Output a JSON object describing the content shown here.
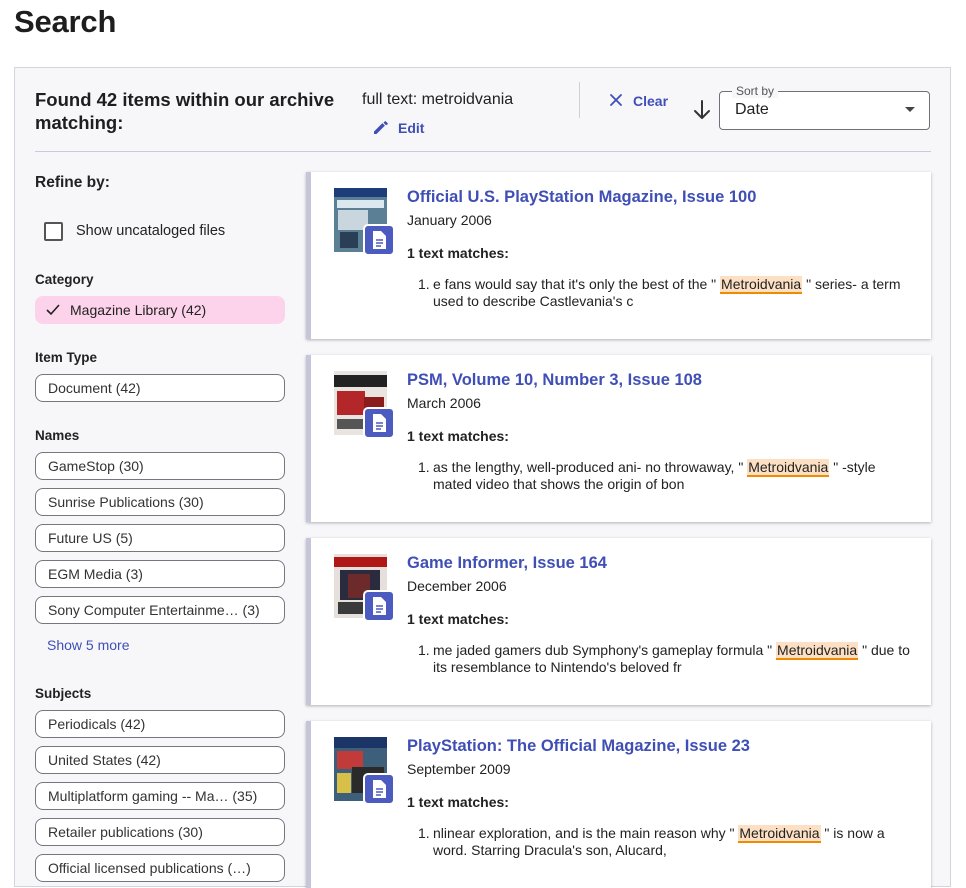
{
  "page": {
    "title": "Search"
  },
  "header": {
    "found_text": "Found 42 items within our archive matching:",
    "query": "full text: metroidvania",
    "edit_label": "Edit",
    "clear_label": "Clear",
    "sort_label": "Sort by",
    "sort_value": "Date",
    "sort_direction": "descending"
  },
  "sidebar": {
    "refine_title": "Refine by:",
    "show_uncataloged_label": "Show uncataloged files",
    "show_uncataloged_checked": false,
    "category": {
      "heading": "Category",
      "items": [
        {
          "label": "Magazine Library (42)",
          "selected": true
        }
      ]
    },
    "item_type": {
      "heading": "Item Type",
      "items": [
        {
          "label": "Document (42)"
        }
      ]
    },
    "names": {
      "heading": "Names",
      "items": [
        {
          "label": "GameStop (30)"
        },
        {
          "label": "Sunrise Publications (30)"
        },
        {
          "label": "Future US (5)"
        },
        {
          "label": "EGM Media (3)"
        },
        {
          "label": "Sony Computer Entertainme… (3)"
        }
      ],
      "show_more": "Show 5 more"
    },
    "subjects": {
      "heading": "Subjects",
      "items": [
        {
          "label": "Periodicals (42)"
        },
        {
          "label": "United States (42)"
        },
        {
          "label": "Multiplatform gaming -- Ma…  (35)"
        },
        {
          "label": "Retailer publications (30)"
        },
        {
          "label": "Official licensed publications (…)"
        }
      ]
    }
  },
  "results": [
    {
      "title": "Official U.S. PlayStation Magazine, Issue 100",
      "date": "January 2006",
      "matches": "1 text matches:",
      "snippet_before": "e fans would say that it's only the best of the \"",
      "snippet_highlight": "Metroidvania",
      "snippet_after": "\" series- a term used to describe Castlevania's c"
    },
    {
      "title": "PSM, Volume 10, Number 3, Issue 108",
      "date": "March 2006",
      "matches": "1 text matches:",
      "snippet_before": "as the lengthy, well-produced ani- no throwaway, \"",
      "snippet_highlight": "Metroidvania",
      "snippet_after": "\" -style mated video that shows the origin of bon"
    },
    {
      "title": "Game Informer, Issue 164",
      "date": "December 2006",
      "matches": "1 text matches:",
      "snippet_before": "me jaded gamers dub Symphony's gameplay formula \"",
      "snippet_highlight": "Metroidvania",
      "snippet_after": "\" due to its resemblance to Nintendo's beloved fr"
    },
    {
      "title": "PlayStation: The Official Magazine, Issue 23",
      "date": "September 2009",
      "matches": "1 text matches:",
      "snippet_before": "nlinear exploration, and is the main reason why \"",
      "snippet_highlight": "Metroidvania",
      "snippet_after": "\" is now a word. Starring Dracula's son, Alucard,"
    }
  ],
  "colors": {
    "accent": "#3f4fb5",
    "selected_chip": "#fcd3ea",
    "highlight_fill": "#fde0c4",
    "highlight_underline": "#f08a00"
  }
}
